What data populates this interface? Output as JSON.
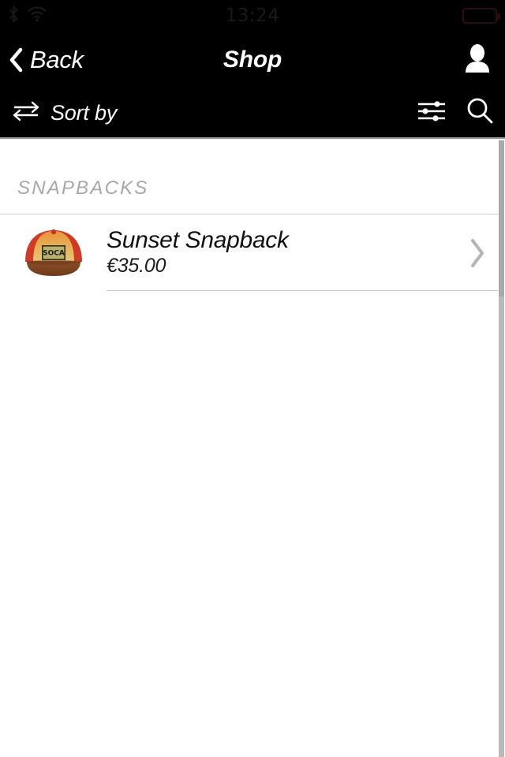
{
  "status_bar": {
    "time": "13:24",
    "icons": {
      "bluetooth": "bluetooth-icon",
      "wifi": "wifi-icon",
      "battery": "battery-icon"
    },
    "colors": {
      "background": "#000000",
      "text": "#191919"
    }
  },
  "nav_bar": {
    "back_label": "Back",
    "back_icon": "chevron-left-icon",
    "title": "Shop",
    "profile_icon": "person-icon",
    "colors": {
      "background": "#000000",
      "text": "#ffffff"
    }
  },
  "sort_bar": {
    "sort_label": "Sort by",
    "sort_icon": "swap-arrows-icon",
    "filter_icon": "sliders-icon",
    "search_icon": "magnifier-icon",
    "colors": {
      "background": "#000000",
      "border": "#8e8e8e"
    }
  },
  "content": {
    "section_title": "SNAPBACKS",
    "section_title_color": "#a8a8a8",
    "products": [
      {
        "name": "Sunset Snapback",
        "price": "€35.00",
        "thumbnail_icon": "snapback-cap-thumbnail",
        "patch_text": "SOCA",
        "chevron_icon": "chevron-right-icon",
        "colors": {
          "crown_front": "#e9a84a",
          "crown_side": "#d8402a",
          "brim": "#8c4a25",
          "patch": "#b9b06a"
        }
      }
    ],
    "colors": {
      "background": "#ffffff",
      "divider": "#c8c8c8"
    }
  },
  "scrollbar": {
    "thumb_color": "#a9a9a9",
    "track_color": "#ffffff"
  }
}
